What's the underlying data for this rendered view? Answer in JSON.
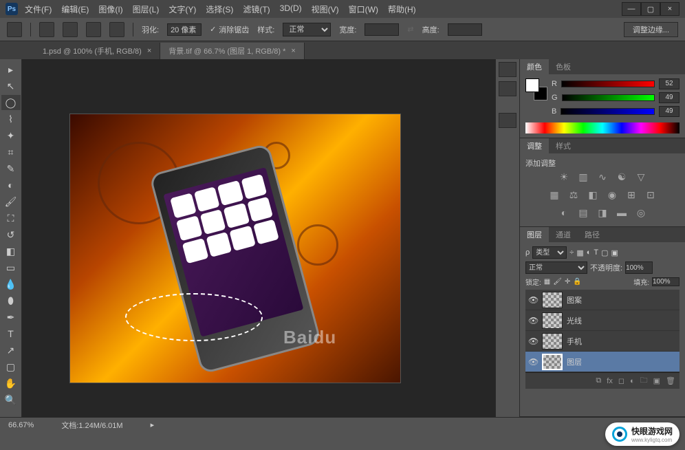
{
  "app": {
    "logo": "Ps"
  },
  "menu": {
    "file": "文件(F)",
    "edit": "编辑(E)",
    "image": "图像(I)",
    "layer": "图层(L)",
    "type": "文字(Y)",
    "select": "选择(S)",
    "filter": "滤镜(T)",
    "threeD": "3D(D)",
    "view": "视图(V)",
    "window": "窗口(W)",
    "help": "帮助(H)"
  },
  "window_controls": {
    "min": "—",
    "max": "▢",
    "close": "×"
  },
  "options": {
    "feather_label": "羽化:",
    "feather_value": "20 像素",
    "antialias": "消除锯齿",
    "style_label": "样式:",
    "style_value": "正常",
    "width_label": "宽度:",
    "height_label": "高度:",
    "refine_edge": "调整边缘..."
  },
  "tabs": [
    {
      "label": "1.psd @ 100% (手机, RGB/8)",
      "active": false
    },
    {
      "label": "背景.tif @ 66.7% (图层 1, RGB/8) *",
      "active": true
    }
  ],
  "color_panel": {
    "tab_color": "颜色",
    "tab_swatch": "色板",
    "r": "R",
    "g": "G",
    "b": "B",
    "r_val": "52",
    "g_val": "49",
    "b_val": "49"
  },
  "adjustments": {
    "tab_adj": "调整",
    "tab_style": "样式",
    "title": "添加调整"
  },
  "layers_panel": {
    "tab_layers": "图层",
    "tab_channels": "通道",
    "tab_paths": "路径",
    "kind": "类型",
    "blend": "正常",
    "opacity_label": "不透明度:",
    "opacity_value": "100%",
    "lock_label": "锁定:",
    "fill_label": "填充:",
    "fill_value": "100%",
    "layers": [
      {
        "name": "图案"
      },
      {
        "name": "光线"
      },
      {
        "name": "手机"
      },
      {
        "name": "图层"
      }
    ]
  },
  "status": {
    "zoom": "66.67%",
    "doc": "文档:1.24M/6.01M"
  },
  "watermark": {
    "brand": "快眼游戏网",
    "url": "www.kyligtq.com",
    "baidu": "Baidu"
  }
}
